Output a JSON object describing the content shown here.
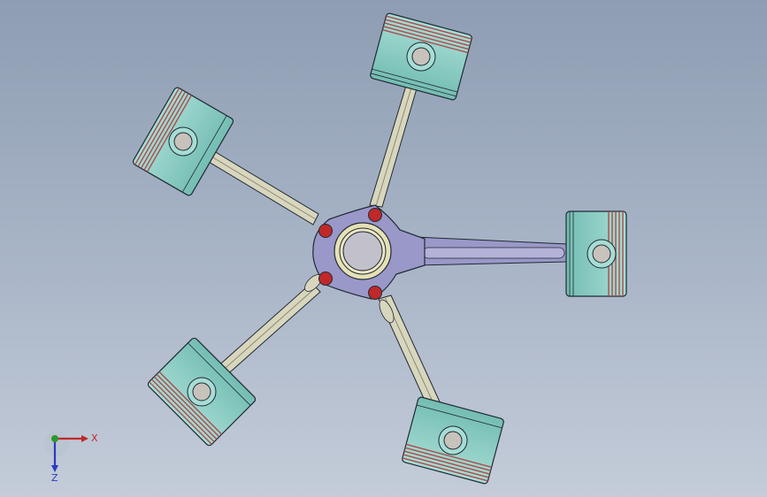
{
  "viewport": {
    "background_top": "#8e9db3",
    "background_bottom": "#c4ccd9"
  },
  "model": {
    "piston_count": 5,
    "colors": {
      "piston_body": "#8ecfc6",
      "piston_ring": "#b04a4a",
      "connecting_rod": "#d8d6bd",
      "master_rod": "#9a98c8",
      "hub": "#9a98c8",
      "bolt": "#c0282a",
      "pin": "#c8c2bc",
      "outline": "#1f2a33"
    }
  },
  "triad": {
    "x_label": "X",
    "z_label": "Z",
    "x_color": "#c0282a",
    "y_color": "#2a9a2a",
    "z_color": "#2a3ac0"
  }
}
